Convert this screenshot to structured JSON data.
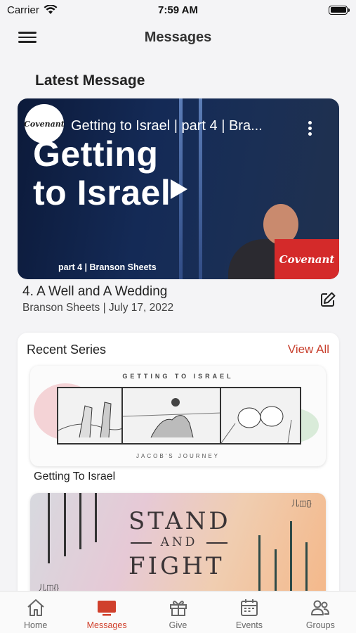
{
  "status_bar": {
    "carrier": "Carrier",
    "time": "7:59 AM"
  },
  "header": {
    "title": "Messages"
  },
  "latest": {
    "section_title": "Latest Message",
    "video": {
      "channel_logo": "Covenant",
      "overlay_title": "Getting to Israel | part 4 | Bra...",
      "big_title_line1": "Getting",
      "big_title_line2": "to Israel",
      "caption": "part 4 | Branson Sheets",
      "brand_badge": "Covenant"
    },
    "message_title": "4. A Well and A Wedding",
    "message_meta": "Branson Sheets | July 17, 2022"
  },
  "series": {
    "heading": "Recent Series",
    "view_all": "View All",
    "items": [
      {
        "art_title": "GETTING TO ISRAEL",
        "art_subtitle": "JACOB'S JOURNEY",
        "label": "Getting To Israel"
      },
      {
        "art_line1": "STAND",
        "art_line2": "AND",
        "art_line3": "FIGHT",
        "art_mark": "儿◫{}"
      }
    ]
  },
  "tabs": [
    {
      "label": "Home",
      "icon": "home-icon",
      "active": false
    },
    {
      "label": "Messages",
      "icon": "tv-icon",
      "active": true
    },
    {
      "label": "Give",
      "icon": "gift-icon",
      "active": false
    },
    {
      "label": "Events",
      "icon": "calendar-icon",
      "active": false
    },
    {
      "label": "Groups",
      "icon": "people-icon",
      "active": false
    }
  ],
  "colors": {
    "accent": "#d0402c",
    "brand_red": "#d42a2a",
    "background": "#f4f4f6"
  }
}
